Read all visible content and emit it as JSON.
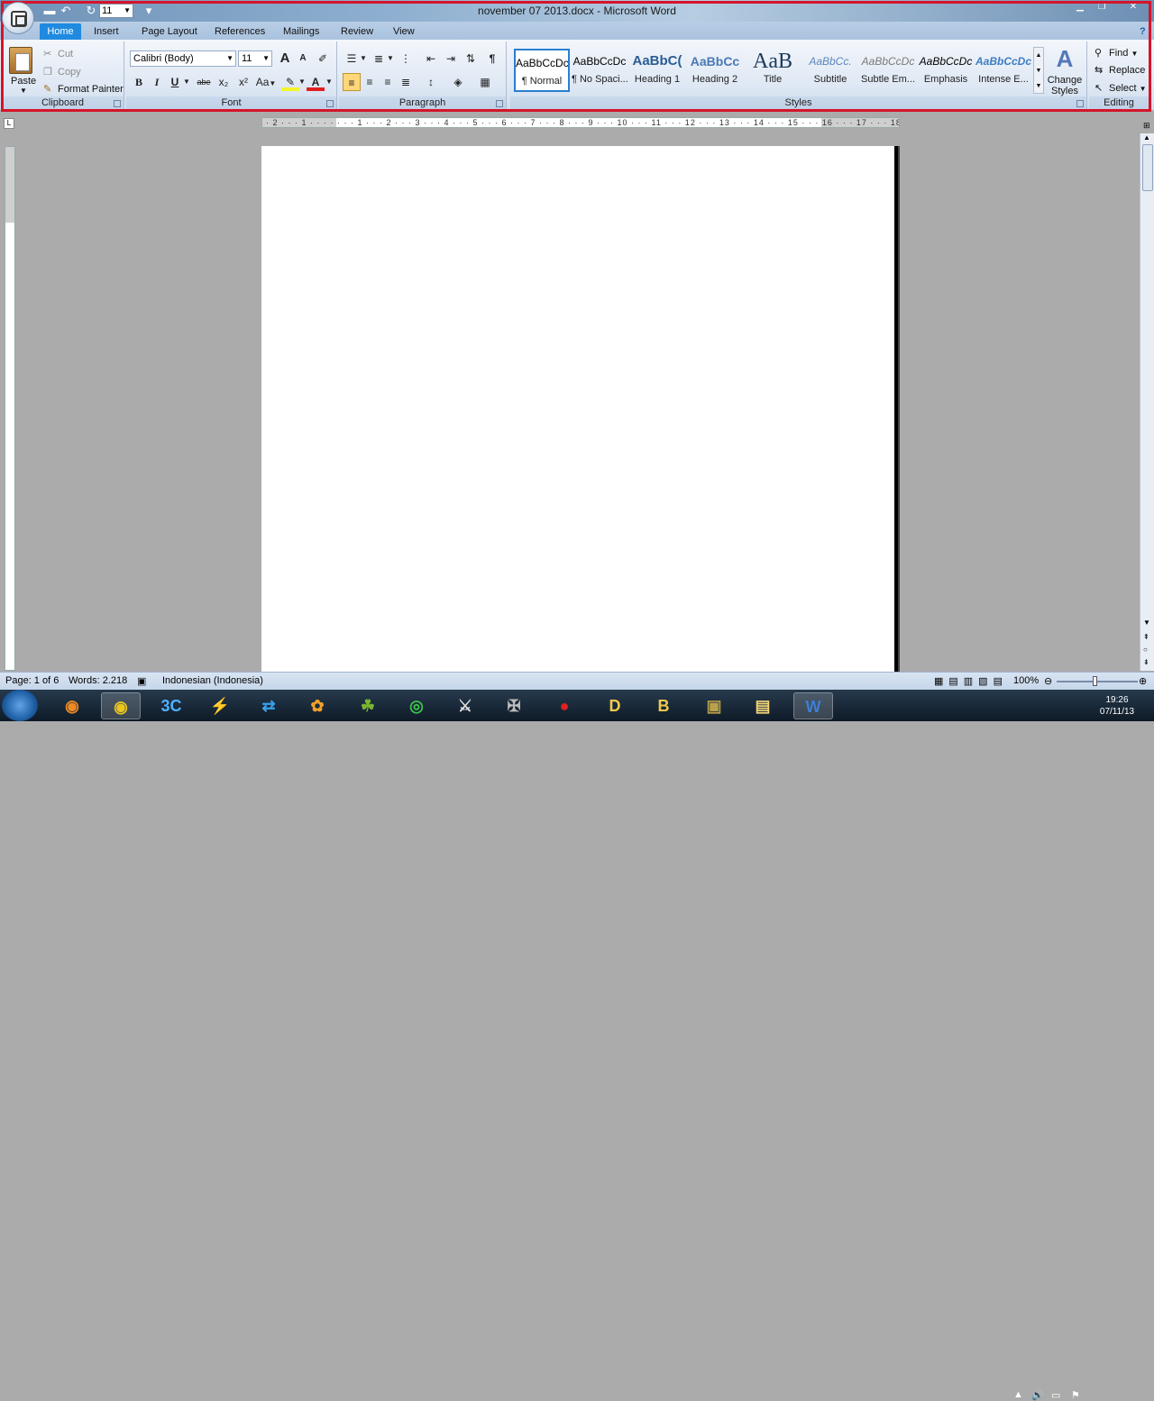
{
  "window": {
    "title": "november 07 2013.docx - Microsoft Word"
  },
  "quick_access": {
    "font_size": "11"
  },
  "tabs": [
    {
      "label": "Home",
      "active": true
    },
    {
      "label": "Insert"
    },
    {
      "label": "Page Layout"
    },
    {
      "label": "References"
    },
    {
      "label": "Mailings"
    },
    {
      "label": "Review"
    },
    {
      "label": "View"
    }
  ],
  "clipboard": {
    "paste": "Paste",
    "cut": "Cut",
    "copy": "Copy",
    "format_painter": "Format Painter",
    "label": "Clipboard"
  },
  "font": {
    "name": "Calibri (Body)",
    "size": "11",
    "label": "Font",
    "bold": "B",
    "italic": "I",
    "underline": "U",
    "strike": "abe",
    "subscript": "x₂",
    "superscript": "x²",
    "change_case": "Aa",
    "font_color": "A",
    "grow": "A",
    "shrink": "A"
  },
  "paragraph": {
    "label": "Paragraph",
    "show_marks": "¶"
  },
  "styles": {
    "label": "Styles",
    "items": [
      {
        "sample": "AaBbCcDc",
        "name": "¶ Normal",
        "selected": true
      },
      {
        "sample": "AaBbCcDc",
        "name": "¶ No Spaci..."
      },
      {
        "sample": "AaBbC(",
        "name": "Heading 1"
      },
      {
        "sample": "AaBbCc",
        "name": "Heading 2"
      },
      {
        "sample": "AaB",
        "name": "Title"
      },
      {
        "sample": "AaBbCc.",
        "name": "Subtitle"
      },
      {
        "sample": "AaBbCcDc",
        "name": "Subtle Em..."
      },
      {
        "sample": "AaBbCcDc",
        "name": "Emphasis"
      },
      {
        "sample": "AaBbCcDc",
        "name": "Intense E..."
      }
    ],
    "change_styles": "Change Styles"
  },
  "editing": {
    "label": "Editing",
    "find": "Find",
    "replace": "Replace",
    "select": "Select"
  },
  "ruler": {
    "ticks": "· 2 · · · 1 · · · · · · · 1 · · · 2 · · · 3 · · · 4 · · · 5 · · · 6 · · · 7 · · · 8 · · · 9 · · · 10 · · · 11 · · · 12 · · · 13 · · · 14 · · · 15 · · · 16 · · · 17 · · · 18 ·"
  },
  "status": {
    "page": "Page: 1 of 6",
    "words": "Words: 2.218",
    "language": "Indonesian (Indonesia)",
    "zoom": "100%"
  },
  "clock": {
    "time": "19:26",
    "date": "07/11/13"
  },
  "colors": {
    "accent": "#1f8ae0",
    "highlight": "#d5142a"
  }
}
